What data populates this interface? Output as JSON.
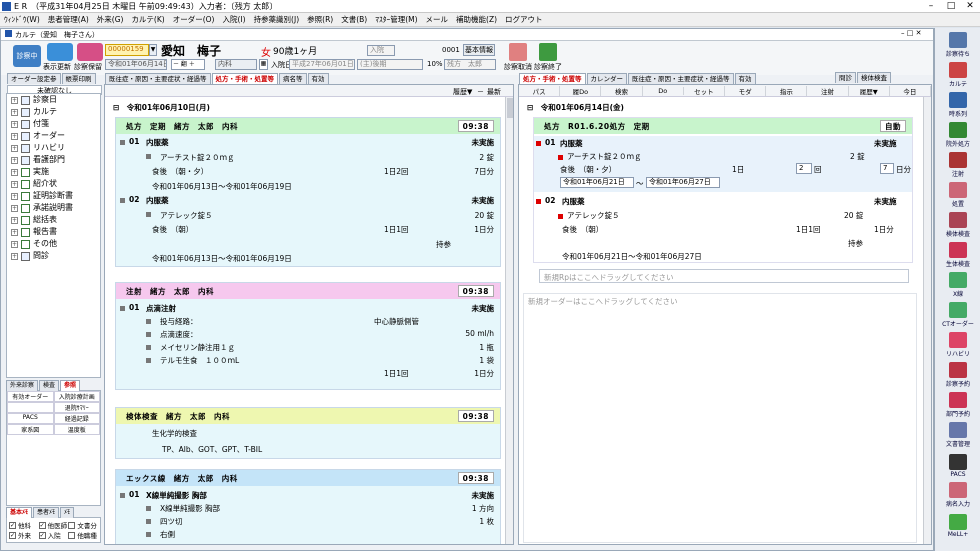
{
  "titlebar": {
    "text": "E R　（平成31年04月25日 木曜日 午前09:49:43）入力者：〔残方 太郎〕"
  },
  "menu": [
    "ｳｨﾝﾄﾞｳ(W)",
    "患者管理(A)",
    "外来(G)",
    "カルテ(K)",
    "オーダー(O)",
    "入院(I)",
    "持参薬識別(J)",
    "参照(R)",
    "文書(B)",
    "ﾏｽﾀｰ管理(M)",
    "メール",
    "補助機能(Z)",
    "ログアウト"
  ],
  "inner_title": "カルテ（愛知　梅子さん）",
  "header": {
    "status": "診察中",
    "btn_display": "表示更新",
    "btn_save": "診察保留",
    "patient_id": "00000159",
    "patient_name": "愛知　梅子",
    "sex": "女",
    "age": "90歳1ヶ月",
    "admit_combo": "入院",
    "code": "0001",
    "basic_info": "基本情報",
    "date_combo": "令和01年06月14日",
    "ward_combo": "内科",
    "admit_label": "入院日",
    "admit_date": "平成27年06月01日",
    "dept_combo": "(主)後期",
    "percent": "10%",
    "doctor": "残方　太郎",
    "btn_cancel": "診察取消",
    "btn_end": "診察終了"
  },
  "left_tabs": [
    "オーダー設定参",
    "帳票印刷"
  ],
  "left_unread": "未確認なし",
  "tree": [
    {
      "label": "診察日",
      "checked": false
    },
    {
      "label": "カルテ",
      "checked": false
    },
    {
      "label": "付箋",
      "checked": false
    },
    {
      "label": "オーダー",
      "checked": false
    },
    {
      "label": "リハビリ",
      "checked": false
    },
    {
      "label": "看護部門",
      "checked": false
    },
    {
      "label": "実施",
      "checked": true
    },
    {
      "label": "紹介状",
      "checked": true
    },
    {
      "label": "証明診断書",
      "checked": true
    },
    {
      "label": "承諾説明書",
      "checked": true
    },
    {
      "label": "総括表",
      "checked": true
    },
    {
      "label": "報告書",
      "checked": true
    },
    {
      "label": "その他",
      "checked": true
    },
    {
      "label": "問診",
      "checked": false
    }
  ],
  "bottom_tabs": [
    "外来診察",
    "検査",
    "参照"
  ],
  "bottom_grid": [
    "有効オーダー",
    "入院診療計画",
    "",
    "退院ｻﾏﾘｰ",
    "PACS",
    "経過記録",
    "家系図",
    "温度板"
  ],
  "bottom_tabs2": [
    "基本ﾒﾓ",
    "患者ﾒﾓ",
    "ﾒﾓ"
  ],
  "checks": [
    {
      "label": "他科",
      "on": true
    },
    {
      "label": "他医師",
      "on": true
    },
    {
      "label": "文書分",
      "on": false
    },
    {
      "label": "外来",
      "on": true
    },
    {
      "label": "入院",
      "on": true
    },
    {
      "label": "他職種",
      "on": false
    }
  ],
  "mid_tabs": [
    "既往症・原因・主要症状・経過等",
    "処方・手術・処置等",
    "病名等",
    "有効"
  ],
  "mid_toolbar": {
    "history": "履歴▼",
    "latest": "最新"
  },
  "mid": {
    "date": "令和01年06月10日(月)",
    "rx": {
      "head": "処方　定期　緒方　太郎　内科",
      "time": "09:38",
      "lines": [
        {
          "a": "01",
          "b": "内服薬",
          "c": "",
          "d": "未実施"
        },
        {
          "a": "",
          "b": "アーチスト錠２０ｍｇ",
          "c": "",
          "d": "2 錠"
        },
        {
          "a": "",
          "b": "食後　（朝・夕）",
          "c": "1日2回",
          "d": "7日分"
        },
        {
          "a": "",
          "b": "令和01年06月13日～令和01年06月19日",
          "c": "",
          "d": ""
        },
        {
          "a": "02",
          "b": "内服薬",
          "c": "",
          "d": "未実施"
        },
        {
          "a": "",
          "b": "アテレック錠５",
          "c": "",
          "d": "20 錠"
        },
        {
          "a": "",
          "b": "食後　（朝）",
          "c": "1日1回",
          "d": "1日分"
        },
        {
          "a": "",
          "b": "",
          "c": "持参",
          "d": ""
        },
        {
          "a": "",
          "b": "令和01年06月13日～令和01年06月19日",
          "c": "",
          "d": ""
        }
      ]
    },
    "inj": {
      "head": "注射　緒方　太郎　内科",
      "time": "09:38",
      "lines": [
        {
          "a": "01",
          "b": "点滴注射",
          "c": "",
          "d": "未実施"
        },
        {
          "a": "",
          "b": "投与経路：",
          "c": "中心静脈側管",
          "d": ""
        },
        {
          "a": "",
          "b": "点滴速度：",
          "c": "",
          "d": "50 ml/h"
        },
        {
          "a": "",
          "b": "メイセリン静注用１ｇ",
          "c": "",
          "d": "1 瓶"
        },
        {
          "a": "",
          "b": "テルモ生食　１００ｍL",
          "c": "",
          "d": "1 袋"
        },
        {
          "a": "",
          "b": "",
          "c": "1日1回",
          "d": "1日分"
        }
      ]
    },
    "lab": {
      "head": "検体検査　緒方　太郎　内科",
      "time": "09:38",
      "lines": [
        {
          "b": "生化学的検査"
        },
        {
          "b": "TP、Alb、GOT、GPT、T-BIL"
        }
      ]
    },
    "xray": {
      "head": "エックス線　緒方　太郎　内科",
      "time": "09:38",
      "lines": [
        {
          "a": "01",
          "b": "X線単純撮影 胸部",
          "c": "",
          "d": "未実施"
        },
        {
          "a": "",
          "b": "X線単純撮影 胸部",
          "c": "",
          "d": "1 方向"
        },
        {
          "a": "",
          "b": "四ツ切",
          "c": "",
          "d": "1 枚"
        },
        {
          "a": "",
          "b": "右側",
          "c": "",
          "d": ""
        }
      ]
    }
  },
  "right_tabs": [
    "処方・手術・処置等",
    "カレンダー",
    "既往症・原因・主要症状・経過等",
    "有効"
  ],
  "right_top": [
    "問診",
    "検体検査"
  ],
  "right_toolbar": [
    "パス",
    "履Do",
    "検索",
    "Do",
    "セット",
    "モダ",
    "指示",
    "注射",
    "履歴▼",
    "今日"
  ],
  "right": {
    "date": "令和01年06月14日(金)",
    "head": "処方　R01.6.20処方　定期",
    "auto": "自動",
    "l1": {
      "no": "01",
      "type": "内服薬",
      "status": "未実施",
      "drug": "アーチスト錠２０ｍｇ",
      "qty": "2 錠",
      "usage": "食後　（朝・夕）",
      "per": "1日",
      "times": "2",
      "times_unit": "回",
      "days": "7",
      "days_unit": "日分",
      "from": "令和01年06月21日",
      "to": "令和01年06月27日"
    },
    "l2": {
      "no": "02",
      "type": "内服薬",
      "status": "未実施",
      "drug": "アテレック錠５",
      "qty": "20 錠",
      "usage": "食後　（朝）",
      "freq": "1日1回",
      "days": "1日分",
      "bring": "持参",
      "period": "令和01年06月21日～令和01年06月27日"
    },
    "drop1": "新規Rpはここへドラッグしてください",
    "drop2": "新規オーダーはここへドラッグしてください"
  },
  "rtool": [
    {
      "label": "診察待ち",
      "color": "#5577aa"
    },
    {
      "label": "カルテ",
      "color": "#cc4444"
    },
    {
      "label": "時系列",
      "color": "#3366aa"
    },
    {
      "label": "院外処方",
      "color": "#338833"
    },
    {
      "label": "注射",
      "color": "#aa3333"
    },
    {
      "label": "処置",
      "color": "#cc6677"
    },
    {
      "label": "検体検査",
      "color": "#aa4455"
    },
    {
      "label": "生体検査",
      "color": "#cc3355"
    },
    {
      "label": "X線",
      "color": "#44aa66"
    },
    {
      "label": "CTオーダー",
      "color": "#44aa66"
    },
    {
      "label": "リハビリ",
      "color": "#dd4466"
    },
    {
      "label": "診察予約",
      "color": "#bb3344"
    },
    {
      "label": "部門予約",
      "color": "#cc3355"
    },
    {
      "label": "文書管理",
      "color": "#6677aa"
    },
    {
      "label": "PACS",
      "color": "#333333"
    },
    {
      "label": "病名入力",
      "color": "#cc6677"
    },
    {
      "label": "MeLL+",
      "color": "#44aa44"
    }
  ]
}
